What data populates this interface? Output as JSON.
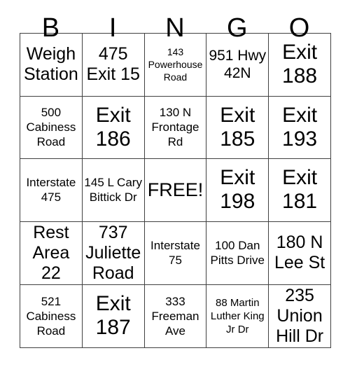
{
  "card": {
    "header_letters": [
      "B",
      "I",
      "N",
      "G",
      "O"
    ],
    "free_space_label": "FREE!",
    "border_color": "#404040",
    "background_color": "#ffffff",
    "text_color": "#000000",
    "rows": [
      [
        {
          "text": "Weigh Station",
          "size": "fs-md"
        },
        {
          "text": "475 Exit 15",
          "size": "fs-md"
        },
        {
          "text": "143 Powerhouse Road",
          "size": "fs-tiny"
        },
        {
          "text": "951 Hwy 42N",
          "size": "fs-sm"
        },
        {
          "text": "Exit 188",
          "size": "fs-xl"
        }
      ],
      [
        {
          "text": "500 Cabiness Road",
          "size": "fs-xs"
        },
        {
          "text": "Exit 186",
          "size": "fs-xl"
        },
        {
          "text": "130 N Frontage Rd",
          "size": "fs-xs"
        },
        {
          "text": "Exit 185",
          "size": "fs-xl"
        },
        {
          "text": "Exit 193",
          "size": "fs-xl"
        }
      ],
      [
        {
          "text": "Interstate 475",
          "size": "fs-xs"
        },
        {
          "text": "145 L Cary Bittick Dr",
          "size": "fs-xs"
        },
        {
          "text": "FREE!",
          "size": "fs-lg"
        },
        {
          "text": "Exit 198",
          "size": "fs-xl"
        },
        {
          "text": "Exit 181",
          "size": "fs-xl"
        }
      ],
      [
        {
          "text": "Rest Area 22",
          "size": "fs-md"
        },
        {
          "text": "737 Juliette Road",
          "size": "fs-md"
        },
        {
          "text": "Interstate 75",
          "size": "fs-xs"
        },
        {
          "text": "100 Dan Pitts Drive",
          "size": "fs-xs"
        },
        {
          "text": "180 N Lee St",
          "size": "fs-md"
        }
      ],
      [
        {
          "text": "521 Cabiness Road",
          "size": "fs-xs"
        },
        {
          "text": "Exit 187",
          "size": "fs-xl"
        },
        {
          "text": "333 Freeman Ave",
          "size": "fs-xs"
        },
        {
          "text": "88 Martin Luther King Jr Dr",
          "size": "fs-xxs"
        },
        {
          "text": "235 Union Hill Dr",
          "size": "fs-md"
        }
      ]
    ]
  }
}
